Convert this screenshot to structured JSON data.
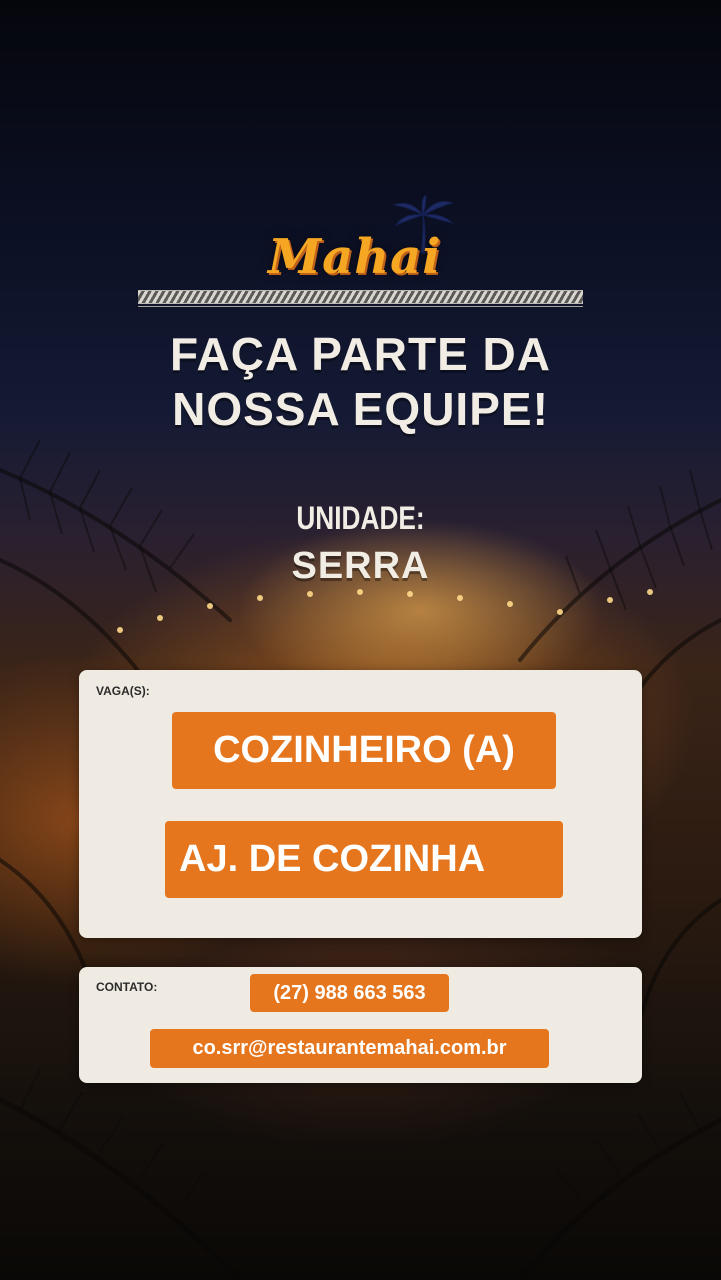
{
  "brand": {
    "logo_text": "Mahai"
  },
  "headline": {
    "line1": "FAÇA PARTE DA",
    "line2": "NOSSA EQUIPE!"
  },
  "unit": {
    "label": "UNIDADE:",
    "value": "SERRA"
  },
  "jobs": {
    "label": "VAGA(S):",
    "items": [
      "COZINHEIRO (A)",
      "AJ. DE COZINHA"
    ]
  },
  "contact": {
    "label": "CONTATO:",
    "phone": "(27) 988 663 563",
    "email": "co.srr@restaurantemahai.com.br"
  },
  "colors": {
    "accent": "#e5761e",
    "logo": "#f5a623",
    "card_bg": "#efebe2",
    "headline": "#f1ece4"
  }
}
